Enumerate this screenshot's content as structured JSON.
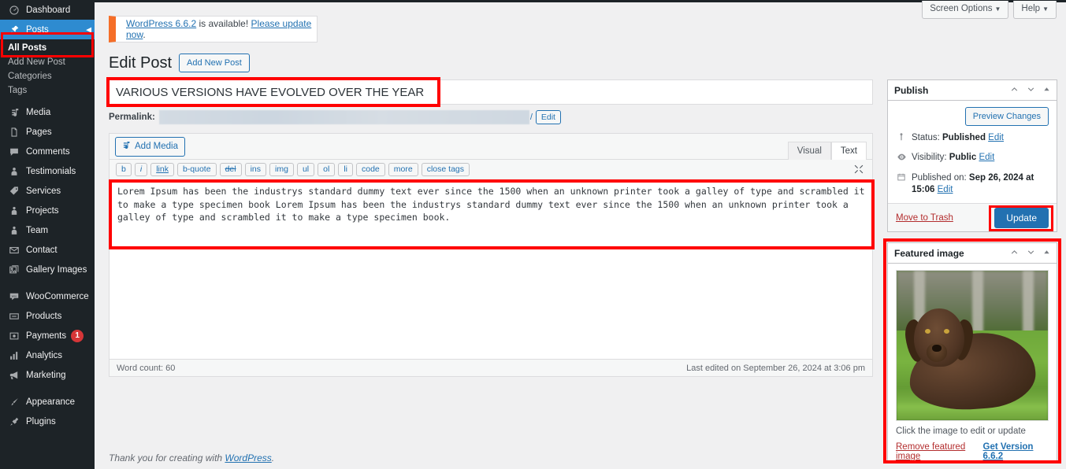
{
  "colors": {
    "admin_dark": "#1d2327",
    "accent_blue": "#2271b1",
    "current_menu_blue": "#2e8bd0",
    "highlight_red": "#ff0000",
    "notice_orange": "#f56e28",
    "danger_red": "#b32d2e",
    "badge_red": "#d63638"
  },
  "sidebar": {
    "items": [
      {
        "label": "Dashboard",
        "icon": "dashboard-icon",
        "current": false
      },
      {
        "label": "Posts",
        "icon": "pin-icon",
        "current": true
      },
      {
        "label": "Media",
        "icon": "media-icon",
        "current": false
      },
      {
        "label": "Pages",
        "icon": "pages-icon",
        "current": false
      },
      {
        "label": "Comments",
        "icon": "comments-icon",
        "current": false
      },
      {
        "label": "Testimonials",
        "icon": "testimonials-icon",
        "current": false
      },
      {
        "label": "Services",
        "icon": "tag-icon",
        "current": false
      },
      {
        "label": "Projects",
        "icon": "projects-icon",
        "current": false
      },
      {
        "label": "Team",
        "icon": "team-icon",
        "current": false
      },
      {
        "label": "Contact",
        "icon": "envelope-icon",
        "current": false
      },
      {
        "label": "Gallery Images",
        "icon": "gallery-icon",
        "current": false
      },
      {
        "label": "WooCommerce",
        "icon": "woocommerce-icon",
        "current": false
      },
      {
        "label": "Products",
        "icon": "products-icon",
        "current": false
      },
      {
        "label": "Payments",
        "icon": "payments-icon",
        "current": false,
        "badge": "1"
      },
      {
        "label": "Analytics",
        "icon": "analytics-icon",
        "current": false
      },
      {
        "label": "Marketing",
        "icon": "megaphone-icon",
        "current": false
      },
      {
        "label": "Appearance",
        "icon": "brush-icon",
        "current": false
      },
      {
        "label": "Plugins",
        "icon": "plug-icon",
        "current": false
      }
    ],
    "posts_submenu": [
      {
        "label": "All Posts",
        "active": true
      },
      {
        "label": "Add New Post",
        "active": false
      },
      {
        "label": "Categories",
        "active": false
      },
      {
        "label": "Tags",
        "active": false
      }
    ]
  },
  "screen_meta": {
    "screen_options": "Screen Options",
    "help": "Help",
    "caret": "▾"
  },
  "notice": {
    "link_version": "WordPress 6.6.2",
    "middle": " is available! ",
    "link_update": "Please update now",
    "period": "."
  },
  "header": {
    "page_title": "Edit Post",
    "add_new_button": "Add New Post"
  },
  "post": {
    "title": "VARIOUS VERSIONS HAVE EVOLVED OVER THE YEAR",
    "permalink_label": "Permalink:",
    "permalink_slash": "/",
    "permalink_edit_button": "Edit",
    "content": "Lorem Ipsum has been the industrys standard dummy text ever since the 1500 when an unknown printer took a galley of type and scrambled it to make a type specimen book Lorem Ipsum has been the industrys standard dummy text ever since the 1500 when an unknown printer took a galley of type and scrambled it to make a type specimen book.",
    "word_count": "Word count: 60",
    "last_edited": "Last edited on September 26, 2024 at 3:06 pm"
  },
  "editor": {
    "add_media": "Add Media",
    "tab_visual": "Visual",
    "tab_text": "Text",
    "quicktags": [
      "b",
      "i",
      "link",
      "b-quote",
      "del",
      "ins",
      "img",
      "ul",
      "ol",
      "li",
      "code",
      "more",
      "close tags"
    ]
  },
  "publish_box": {
    "title": "Publish",
    "preview_button": "Preview Changes",
    "status_label": "Status:",
    "status_value": "Published",
    "status_edit": "Edit",
    "visibility_label": "Visibility:",
    "visibility_value": "Public",
    "visibility_edit": "Edit",
    "published_label": "Published on:",
    "published_value": "Sep 26, 2024 at 15:06",
    "published_edit": "Edit",
    "trash_link": "Move to Trash",
    "update_button": "Update"
  },
  "featured_image_box": {
    "title": "Featured image",
    "caption": "Click the image to edit or update",
    "remove_link": "Remove featured image",
    "get_version_link": "Get Version 6.6.2",
    "image_description": "Brown long-haired dog lying on green grass"
  },
  "footer": {
    "thanks_prefix": "Thank you for creating with ",
    "thanks_link": "WordPress",
    "thanks_suffix": "."
  }
}
